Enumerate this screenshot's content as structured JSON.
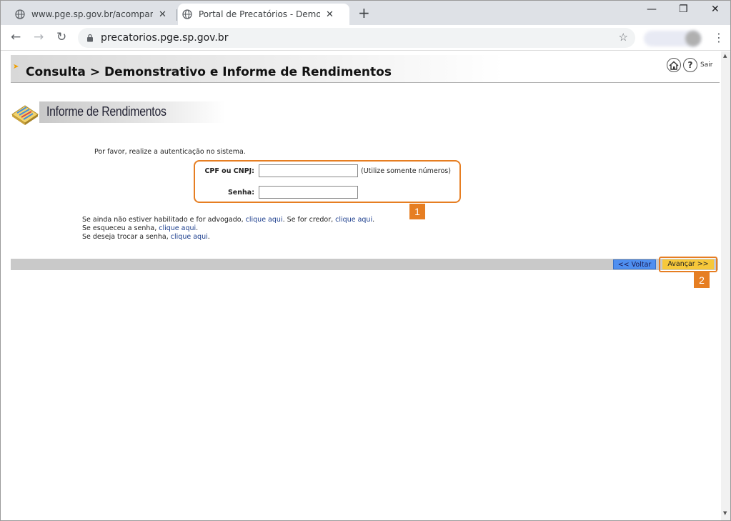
{
  "browser": {
    "tabs": [
      {
        "title": "www.pge.sp.gov.br/acompanhe/p",
        "close": "✕"
      },
      {
        "title": "Portal de Precatórios - Demonstr",
        "close": "✕"
      }
    ],
    "new_tab": "+",
    "window_controls": {
      "minimize": "—",
      "restore": "❐",
      "close": "✕"
    },
    "nav": {
      "back": "←",
      "forward": "→",
      "reload": "↻"
    },
    "url": "precatorios.pge.sp.gov.br",
    "star": "☆",
    "menu": "⋮"
  },
  "page": {
    "header_arrow": "➤",
    "header_title": "Consulta > Demonstrativo e Informe de Rendimentos",
    "home_icon": "⌂",
    "help_icon": "?",
    "logout_label": "Sair",
    "section_title": "Informe de Rendimentos",
    "auth_message": "Por favor, realize a autenticação no sistema.",
    "form": {
      "cpf_label": "CPF ou CNPJ:",
      "cpf_value": "",
      "cpf_hint": "(Utilize somente números)",
      "password_label": "Senha:",
      "password_value": ""
    },
    "help_lines": {
      "line1_a": "Se ainda não estiver habilitado e for advogado, ",
      "line1_link1": "clique aqui",
      "line1_b": ". Se for credor, ",
      "line1_link2": "clique aqui",
      "line1_c": ".",
      "line2_a": "Se esqueceu a senha, ",
      "line2_link": "clique aqui",
      "line2_b": ".",
      "line3_a": "Se deseja trocar a senha, ",
      "line3_link": "clique aqui",
      "line3_b": "."
    },
    "buttons": {
      "back": "<< Voltar",
      "next": "Avançar >>"
    },
    "annotations": {
      "badge1": "1",
      "badge2": "2"
    }
  },
  "colors": {
    "annotation": "#e67e22",
    "back_button": "#4f8ff0",
    "next_button": "#f6c83a"
  }
}
